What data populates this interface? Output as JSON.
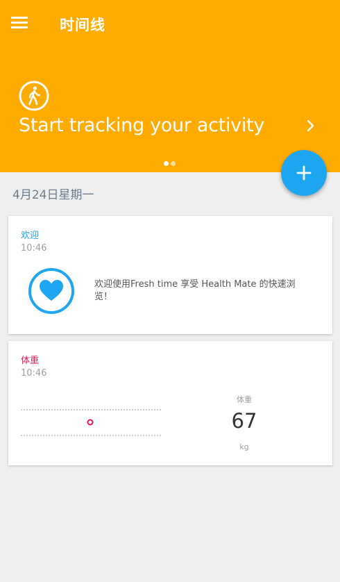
{
  "app": {
    "title": "时间线"
  },
  "colors": {
    "header": "#ffab00",
    "fab": "#1ea7f0",
    "welcome_accent": "#1ea7f0",
    "weight_accent": "#e6195a"
  },
  "banner": {
    "text": "Start tracking your activity",
    "icon": "walking-person-icon",
    "pager_total": 2,
    "pager_active": 1
  },
  "fab": {
    "icon": "plus-icon"
  },
  "timeline": {
    "date": "4月24日星期一",
    "cards": {
      "welcome": {
        "title": "欢迎",
        "time": "10:46",
        "icon": "heart-icon",
        "message": "欢迎使用Fresh time 享受 Health Mate 的快速浏览！"
      },
      "weight": {
        "title": "体重",
        "time": "10:46",
        "value_label": "体重",
        "value": "67",
        "unit": "kg"
      }
    }
  }
}
